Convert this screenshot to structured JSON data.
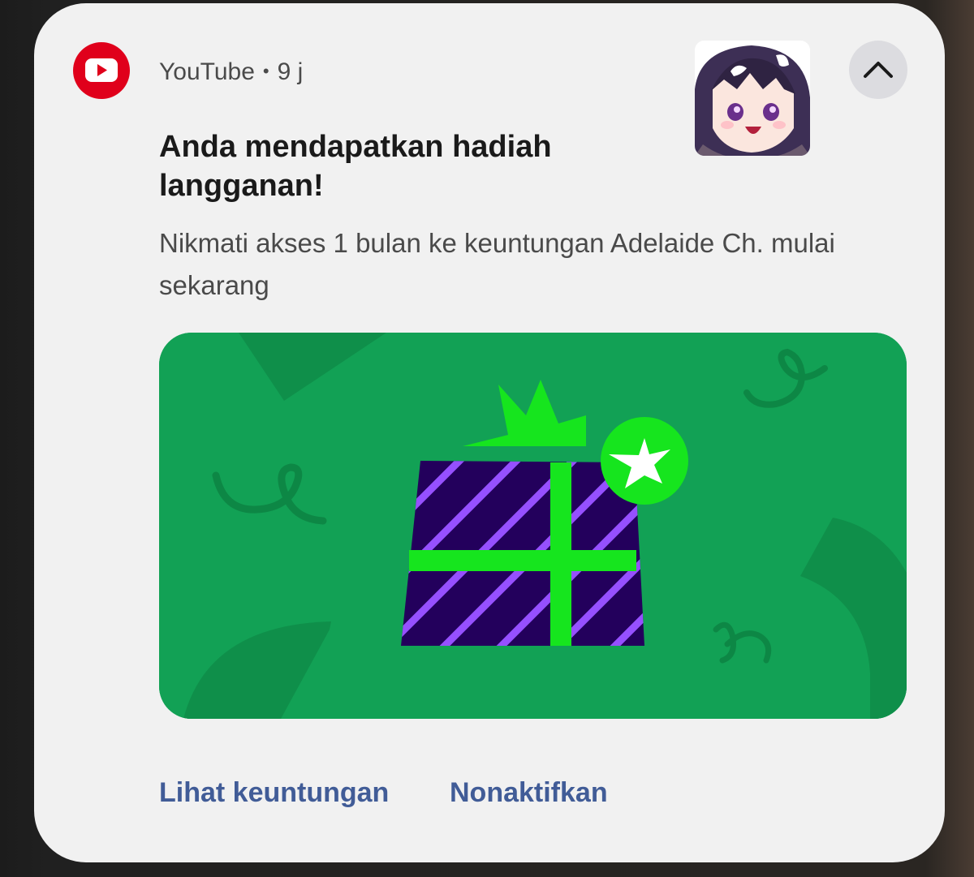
{
  "notification": {
    "app_name": "YouTube",
    "separator": "•",
    "time": "9 j",
    "title": "Anda mendapatkan hadiah langganan!",
    "body": "Nikmati akses 1 bulan ke keuntungan Adelaide Ch. mulai sekarang",
    "actions": {
      "view_benefits": "Lihat keuntungan",
      "disable": "Nonaktifkan"
    },
    "icons": {
      "app": "youtube-logo-icon",
      "collapse": "chevron-up-icon",
      "gift": "gift-box-icon",
      "star_badge": "star-badge-icon"
    },
    "colors": {
      "brand_red": "#e0001b",
      "banner_green": "#12a155",
      "accent_lime": "#16e51e",
      "gift_purple": "#23005c",
      "stripe_violet": "#9650ff",
      "action_blue": "#415c97"
    }
  }
}
